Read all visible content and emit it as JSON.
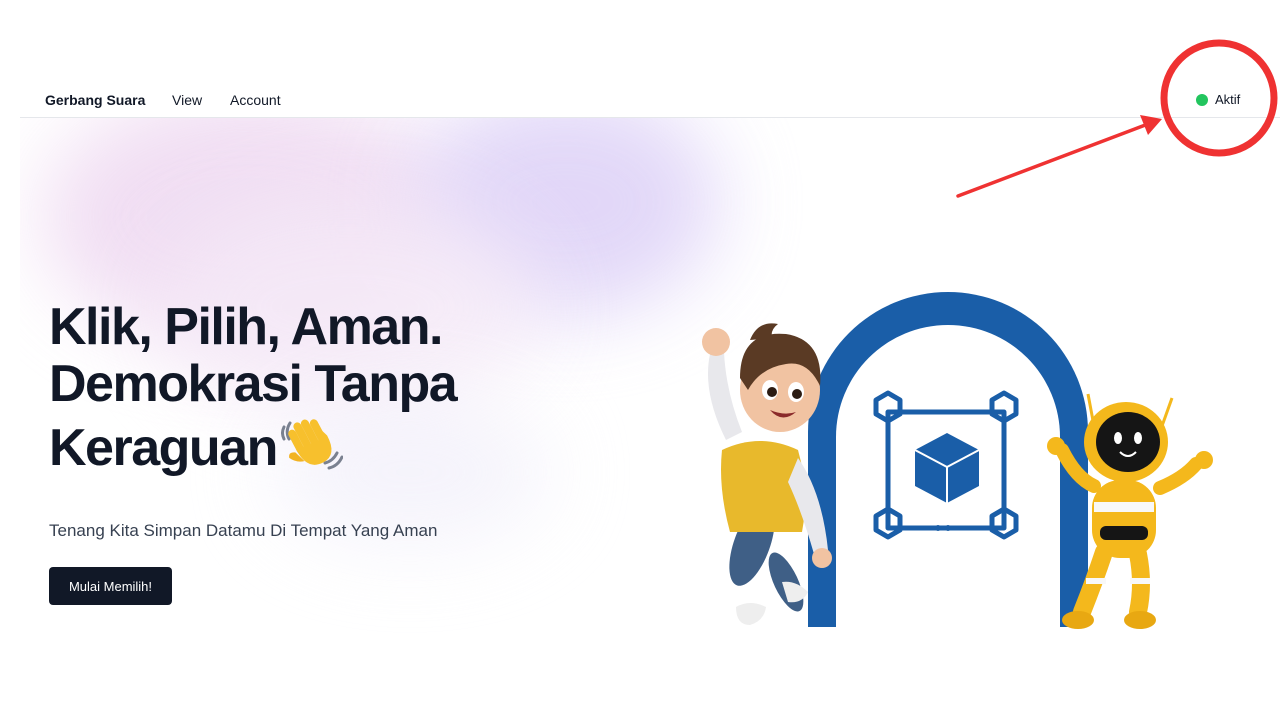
{
  "nav": {
    "brand": "Gerbang Suara",
    "links": [
      {
        "label": "View"
      },
      {
        "label": "Account"
      }
    ],
    "status": {
      "label": "Aktif",
      "color": "#22c55e"
    }
  },
  "hero": {
    "headline_lines": [
      "Klik, Pilih, Aman.",
      "Demokrasi Tanpa",
      "Keraguan"
    ],
    "headline_emoji_icon": "waving-hand-icon",
    "subtitle": "Tenang Kita Simpan Datamu Di Tempat Yang Aman",
    "cta_label": "Mulai Memilih!"
  },
  "illustration": {
    "icons": [
      "boy-character-icon",
      "blockchain-arch-icon",
      "robot-character-icon"
    ]
  },
  "annotation": {
    "color": "#ef3232"
  },
  "colors": {
    "text": "#111827",
    "button_bg": "#111827",
    "arch_blue": "#1a5ea8",
    "robot_yellow": "#f4b81c",
    "status_green": "#22c55e"
  }
}
